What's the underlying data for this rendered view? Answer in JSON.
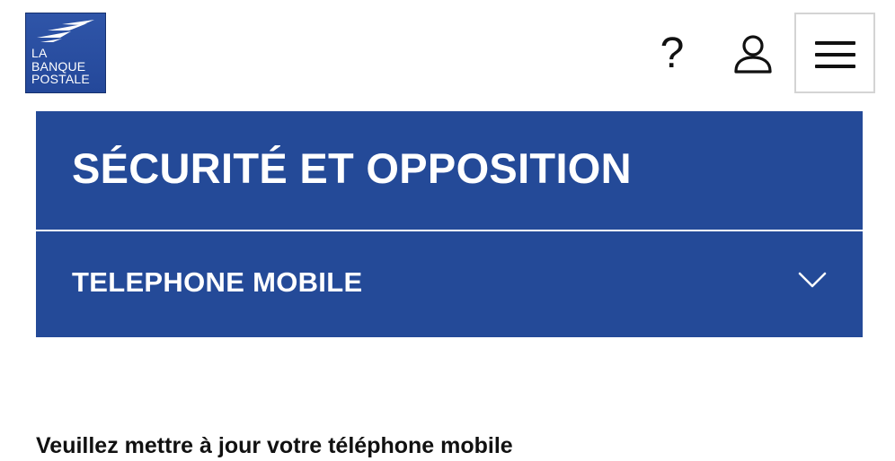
{
  "header": {
    "logo": {
      "lines": [
        "LA",
        "BANQUE",
        "POSTALE"
      ],
      "icon": "bird-icon",
      "colors": {
        "background": "#24489a",
        "text": "#ffffff"
      }
    },
    "help": {
      "label": "?",
      "icon": "question-icon"
    },
    "account": {
      "icon": "user-icon"
    },
    "menu": {
      "icon": "hamburger-icon"
    }
  },
  "page": {
    "title": "SÉCURITÉ ET OPPOSITION",
    "accordion": {
      "label": "TELEPHONE MOBILE",
      "icon": "chevron-down-icon",
      "expanded": false
    },
    "message": "Veuillez mettre à jour votre téléphone mobile"
  },
  "theme": {
    "primary": "#244a98",
    "text": "#111111",
    "border": "#d4d4d4"
  }
}
